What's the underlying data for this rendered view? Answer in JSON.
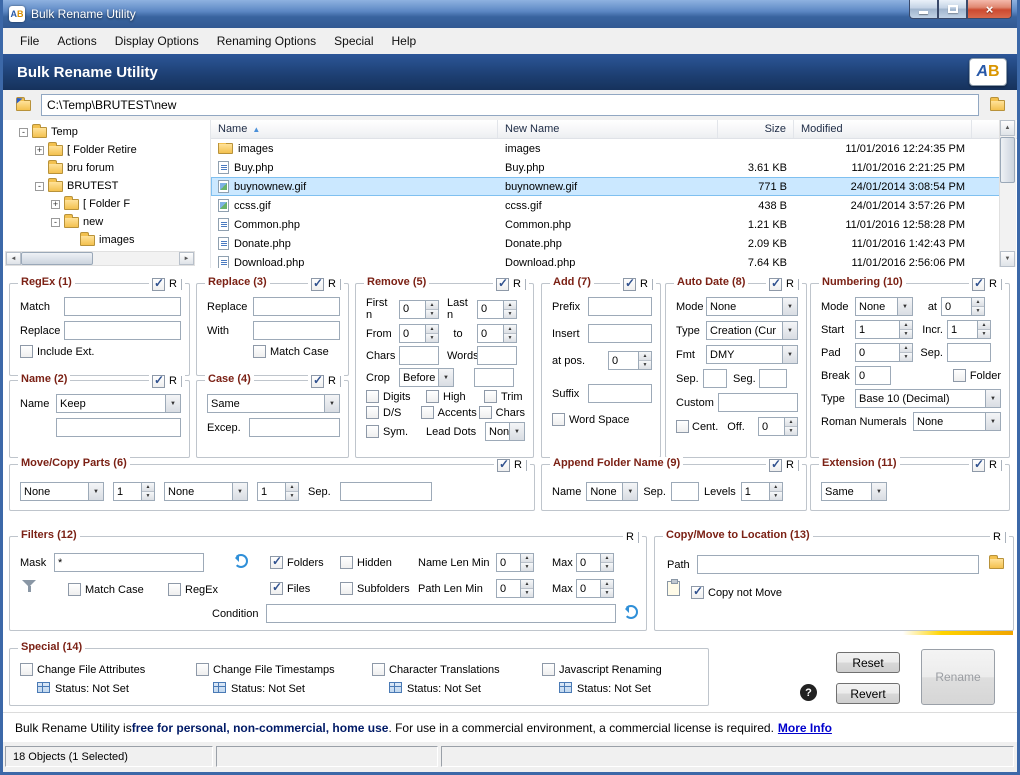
{
  "colors": {
    "titlebar_blue": "#3c68a8",
    "banner_navy": "#1d3f72",
    "group_title_maroon": "#7b2115",
    "selection_blue": "#cbe8ff",
    "link_blue": "#0000cc",
    "accent_yellow": "#ffd400",
    "close_red": "#cc4a30"
  },
  "icons": {
    "close": "×",
    "sort_asc": "▲",
    "combo_arrow": "▼",
    "spin_up": "▲",
    "spin_down": "▼",
    "scroll_up": "▲",
    "scroll_down": "▼",
    "scroll_left": "◄",
    "scroll_right": "►",
    "help": "?"
  },
  "window": {
    "title": "Bulk Rename Utility",
    "logo_a": "A",
    "logo_b": "B"
  },
  "menu": {
    "items": [
      "File",
      "Actions",
      "Display Options",
      "Renaming Options",
      "Special",
      "Help"
    ]
  },
  "banner": {
    "title": "Bulk Rename Utility",
    "logo_a": "A",
    "logo_b": "B"
  },
  "address": {
    "value": "C:\\Temp\\BRUTEST\\new"
  },
  "tree": {
    "items": [
      {
        "label": "Temp",
        "exp": "-"
      },
      {
        "label": "[ Folder Retire",
        "exp": "+"
      },
      {
        "label": "bru forum",
        "exp": ""
      },
      {
        "label": "BRUTEST",
        "exp": "-"
      },
      {
        "label": "[ Folder F",
        "exp": "+"
      },
      {
        "label": "new",
        "exp": "-"
      },
      {
        "label": "images",
        "exp": ""
      }
    ]
  },
  "filelist": {
    "columns": {
      "name": "Name",
      "new_name": "New Name",
      "size": "Size",
      "modified": "Modified"
    },
    "sort": {
      "column": "name",
      "indicator": "▲"
    },
    "rows": [
      {
        "name": "images",
        "new_name": "images",
        "size": "",
        "modified": "11/01/2016 12:24:35 PM",
        "selected": false
      },
      {
        "name": "Buy.php",
        "new_name": "Buy.php",
        "size": "3.61 KB",
        "modified": "11/01/2016 2:21:25 PM",
        "selected": false
      },
      {
        "name": "buynownew.gif",
        "new_name": "buynownew.gif",
        "size": "771 B",
        "modified": "24/01/2014 3:08:54 PM",
        "selected": true
      },
      {
        "name": "ccss.gif",
        "new_name": "ccss.gif",
        "size": "438 B",
        "modified": "24/01/2014 3:57:26 PM",
        "selected": false
      },
      {
        "name": "Common.php",
        "new_name": "Common.php",
        "size": "1.21 KB",
        "modified": "11/01/2016 12:58:28 PM",
        "selected": false
      },
      {
        "name": "Donate.php",
        "new_name": "Donate.php",
        "size": "2.09 KB",
        "modified": "11/01/2016 1:42:43 PM",
        "selected": false
      },
      {
        "name": "Download.php",
        "new_name": "Download.php",
        "size": "7.64 KB",
        "modified": "11/01/2016 2:56:06 PM",
        "selected": false
      }
    ]
  },
  "common": {
    "r": "R"
  },
  "panels": {
    "regex": {
      "title": "RegEx (1)",
      "enabled": true,
      "match_label": "Match",
      "match_value": "",
      "replace_label": "Replace",
      "replace_value": "",
      "include_ext_label": "Include Ext.",
      "include_ext_checked": false
    },
    "name": {
      "title": "Name (2)",
      "enabled": true,
      "name_label": "Name",
      "mode": "Keep",
      "value": ""
    },
    "replace": {
      "title": "Replace (3)",
      "enabled": true,
      "replace_label": "Replace",
      "replace_value": "",
      "with_label": "With",
      "with_value": "",
      "match_case_label": "Match Case",
      "match_case_checked": false
    },
    "case": {
      "title": "Case (4)",
      "enabled": true,
      "mode": "Same",
      "excep_label": "Excep.",
      "excep_value": ""
    },
    "remove": {
      "title": "Remove (5)",
      "enabled": true,
      "first_n_label": "First n",
      "first_n": "0",
      "last_n_label": "Last n",
      "last_n": "0",
      "from_label": "From",
      "from": "0",
      "to_label": "to",
      "to": "0",
      "chars_label": "Chars",
      "chars_value": "",
      "words_label": "Words",
      "words_value": "",
      "crop_label": "Crop",
      "crop_mode": "Before",
      "crop_value": "",
      "digits_label": "Digits",
      "digits_checked": false,
      "high_label": "High",
      "high_checked": false,
      "trim_label": "Trim",
      "trim_checked": false,
      "ds_label": "D/S",
      "ds_checked": false,
      "accents_label": "Accents",
      "accents_checked": false,
      "chars_cb_label": "Chars",
      "chars_cb_checked": false,
      "sym_label": "Sym.",
      "sym_checked": false,
      "lead_dots_label": "Lead Dots",
      "lead_dots_mode": "Non"
    },
    "add": {
      "title": "Add (7)",
      "enabled": true,
      "prefix_label": "Prefix",
      "prefix_value": "",
      "insert_label": "Insert",
      "insert_value": "",
      "at_pos_label": "at pos.",
      "at_pos": "0",
      "suffix_label": "Suffix",
      "suffix_value": "",
      "word_space_label": "Word Space",
      "word_space_checked": false
    },
    "autodate": {
      "title": "Auto Date (8)",
      "enabled": true,
      "mode_label": "Mode",
      "mode": "None",
      "type_label": "Type",
      "type": "Creation (Cur",
      "fmt_label": "Fmt",
      "fmt": "DMY",
      "sep_label": "Sep.",
      "sep_value": "",
      "seg_label": "Seg.",
      "seg_value": "",
      "custom_label": "Custom",
      "custom_value": "",
      "cent_label": "Cent.",
      "cent_checked": false,
      "off_label": "Off.",
      "off": "0"
    },
    "numbering": {
      "title": "Numbering (10)",
      "enabled": true,
      "mode_label": "Mode",
      "mode": "None",
      "at_label": "at",
      "at": "0",
      "start_label": "Start",
      "start": "1",
      "incr_label": "Incr.",
      "incr": "1",
      "pad_label": "Pad",
      "pad": "0",
      "sep_label": "Sep.",
      "sep_value": "",
      "break_label": "Break",
      "break_value": "0",
      "folder_label": "Folder",
      "folder_checked": false,
      "type_label": "Type",
      "type": "Base 10 (Decimal)",
      "roman_label": "Roman Numerals",
      "roman": "None"
    },
    "movecopy": {
      "title": "Move/Copy Parts (6)",
      "enabled": true,
      "mode1": "None",
      "count1": "1",
      "mode2": "None",
      "count2": "1",
      "sep_label": "Sep.",
      "sep_value": ""
    },
    "appendfolder": {
      "title": "Append Folder Name (9)",
      "enabled": true,
      "name_label": "Name",
      "mode": "None",
      "sep_label": "Sep.",
      "sep_value": "",
      "levels_label": "Levels",
      "levels": "1"
    },
    "extension": {
      "title": "Extension (11)",
      "enabled": true,
      "mode": "Same"
    },
    "filters": {
      "title": "Filters (12)",
      "mask_label": "Mask",
      "mask_value": "*",
      "folders_label": "Folders",
      "folders_checked": true,
      "hidden_label": "Hidden",
      "hidden_checked": false,
      "files_label": "Files",
      "files_checked": true,
      "subfolders_label": "Subfolders",
      "subfolders_checked": false,
      "match_case_label": "Match Case",
      "match_case_checked": false,
      "regex_label": "RegEx",
      "regex_checked": false,
      "name_len_label": "Name Len Min",
      "path_len_label": "Path Len Min",
      "max_label": "Max",
      "name_len_min": "0",
      "name_len_max": "0",
      "path_len_min": "0",
      "path_len_max": "0",
      "condition_label": "Condition",
      "condition_value": ""
    },
    "copymove": {
      "title": "Copy/Move to Location (13)",
      "path_label": "Path",
      "path_value": "",
      "copy_not_move_label": "Copy not Move",
      "copy_not_move_checked": true
    },
    "special": {
      "title": "Special (14)",
      "items": [
        {
          "label": "Change File Attributes",
          "status": "Status: Not Set",
          "checked": false
        },
        {
          "label": "Change File Timestamps",
          "status": "Status: Not Set",
          "checked": false
        },
        {
          "label": "Character Translations",
          "status": "Status: Not Set",
          "checked": false
        },
        {
          "label": "Javascript Renaming",
          "status": "Status: Not Set",
          "checked": false
        }
      ]
    }
  },
  "buttons": {
    "reset": "Reset",
    "revert": "Revert",
    "rename": "Rename"
  },
  "license": {
    "part1": "Bulk Rename Utility is ",
    "bold": "free for personal, non-commercial, home use",
    "part2": ". For use in a commercial environment, a commercial license is required.",
    "link": "More Info"
  },
  "statusbar": {
    "objects": "18 Objects (1 Selected)"
  }
}
